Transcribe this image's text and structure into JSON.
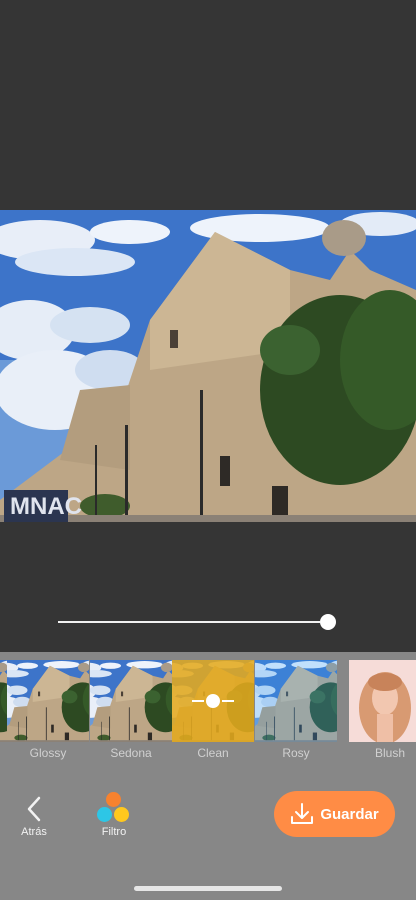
{
  "photo": {
    "sign_text": "MNAC"
  },
  "slider": {
    "intensity": 1.0
  },
  "filters": {
    "items": [
      {
        "label": ""
      },
      {
        "label": "Glossy"
      },
      {
        "label": "Sedona"
      },
      {
        "label": "Clean"
      },
      {
        "label": "Rosy"
      },
      {
        "label": "Blush"
      }
    ],
    "selected": "Clean"
  },
  "toolbar": {
    "back_label": "Atrás",
    "filter_label": "Filtro",
    "save_label": "Guardar"
  },
  "colors": {
    "background": "#353535",
    "panel": "#878787",
    "accent": "#ff8c45",
    "filter_dots": [
      "#f7822f",
      "#2dc6e6",
      "#ffc81e"
    ],
    "selected_overlay": "#e4aa1e"
  },
  "icons": {
    "back": "chevron-left-icon",
    "filter": "three-dots-filter-icon",
    "save": "download-icon",
    "selected_filter": "adjust-slider-icon"
  }
}
